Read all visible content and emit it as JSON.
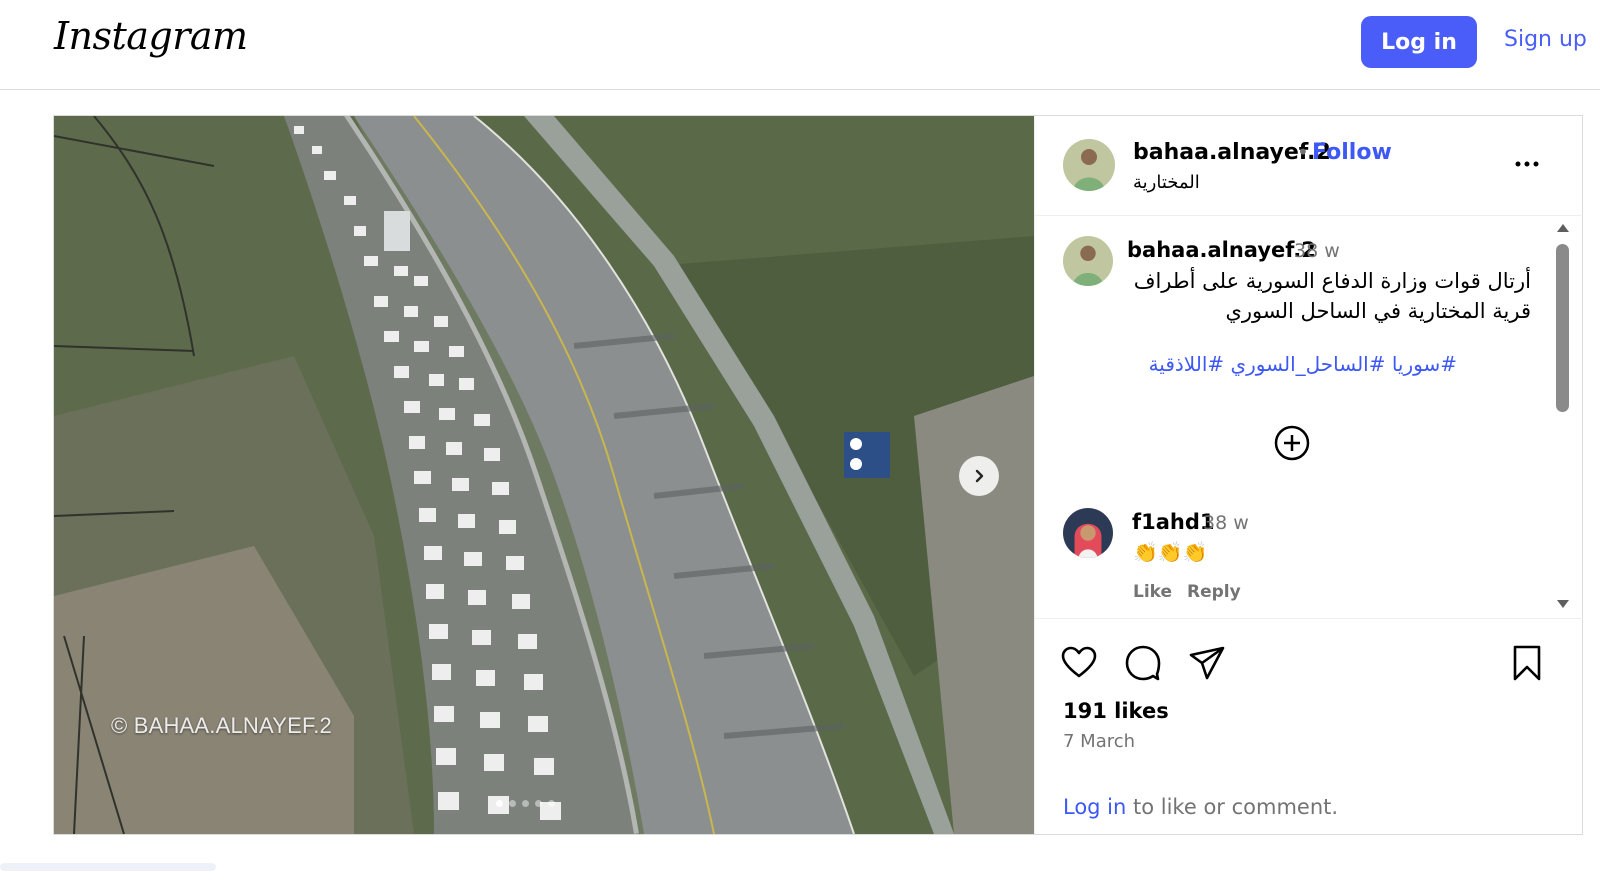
{
  "header": {
    "logo_text": "Instagram",
    "login_label": "Log in",
    "signup_label": "Sign up"
  },
  "media": {
    "watermark": "© BAHAA.ALNAYEF.2",
    "carousel_count": 5,
    "active_index": 0
  },
  "post_header": {
    "username": "bahaa.alnayef.2",
    "separator": "•",
    "follow_label": "Follow",
    "location": "المختارية"
  },
  "caption": {
    "username": "bahaa.alnayef.2",
    "time": "38 w",
    "text": "أرتال قوات وزارة الدفاع السورية على أطراف قرية المختارية في الساحل السوري",
    "hashtags": "#سوريا #الساحل_السوري #اللاذقية"
  },
  "comment": {
    "username": "f1ahd1",
    "time": "38 w",
    "text": "👏👏👏",
    "like_label": "Like",
    "reply_label": "Reply"
  },
  "footer": {
    "likes": "191 likes",
    "date": "7 March",
    "login_link": "Log in",
    "login_suffix": " to like or comment."
  },
  "colors": {
    "accent": "#4a5df9",
    "link": "#3d58f5",
    "muted": "#737373"
  }
}
